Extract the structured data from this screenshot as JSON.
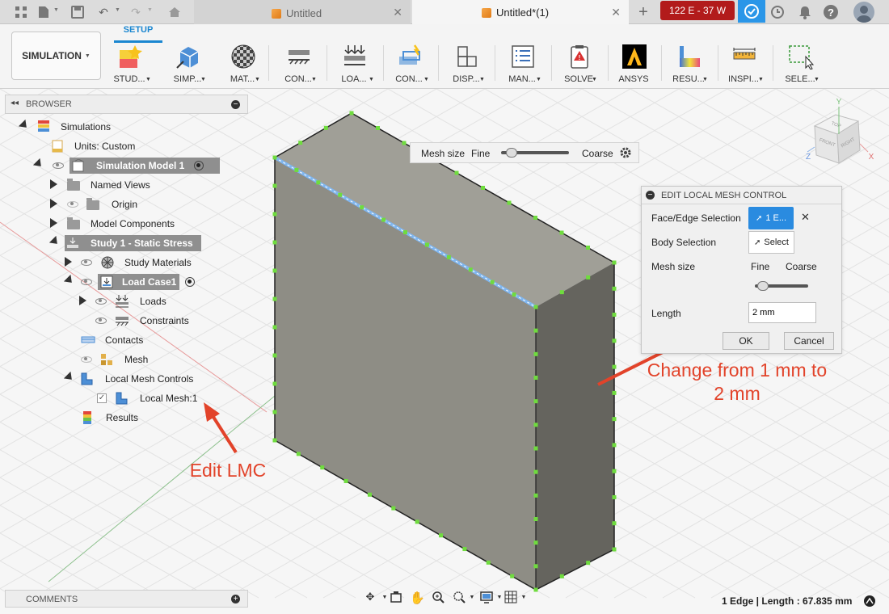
{
  "titlebar": {
    "tabs": [
      {
        "label": "Untitled",
        "active": false
      },
      {
        "label": "Untitled*(1)",
        "active": true
      }
    ],
    "job_status": "122 E - 37 W",
    "icons": [
      "file-icon",
      "save-icon",
      "undo-icon",
      "redo-icon",
      "home-icon",
      "add-tab-icon",
      "sync-icon",
      "clock-icon",
      "bell-icon",
      "help-icon",
      "user-avatar"
    ]
  },
  "ribbon": {
    "workspace": "SIMULATION",
    "active_tab": "SETUP",
    "tools": [
      {
        "label": "STUD...",
        "icon": "study-icon"
      },
      {
        "label": "SIMP...",
        "icon": "simplify-icon"
      },
      {
        "label": "MAT...",
        "icon": "material-icon"
      },
      {
        "label": "CON...",
        "icon": "constraints-icon"
      },
      {
        "label": "LOA...",
        "icon": "loads-icon"
      },
      {
        "label": "CON...",
        "icon": "contacts-icon"
      },
      {
        "label": "DISP...",
        "icon": "display-icon"
      },
      {
        "label": "MAN...",
        "icon": "manage-icon"
      },
      {
        "label": "SOLVE",
        "icon": "solve-icon"
      },
      {
        "label": "ANSYS",
        "icon": "ansys-icon"
      },
      {
        "label": "RESU...",
        "icon": "results-icon"
      },
      {
        "label": "INSPI...",
        "icon": "inspect-icon"
      },
      {
        "label": "SELE...",
        "icon": "select-icon"
      }
    ]
  },
  "browser": {
    "title": "BROWSER",
    "tree": [
      {
        "label": "Simulations"
      },
      {
        "label": "Units: Custom"
      },
      {
        "label": "Simulation Model 1"
      },
      {
        "label": "Named Views"
      },
      {
        "label": "Origin"
      },
      {
        "label": "Model Components"
      },
      {
        "label": "Study 1 - Static Stress"
      },
      {
        "label": "Study Materials"
      },
      {
        "label": "Load Case1"
      },
      {
        "label": "Loads"
      },
      {
        "label": "Constraints"
      },
      {
        "label": "Contacts"
      },
      {
        "label": "Mesh"
      },
      {
        "label": "Local Mesh Controls"
      },
      {
        "label": "Local Mesh:1"
      },
      {
        "label": "Results"
      }
    ]
  },
  "comments": {
    "title": "COMMENTS"
  },
  "meshbar": {
    "label": "Mesh size",
    "fine": "Fine",
    "coarse": "Coarse",
    "level": 0.15
  },
  "dialog": {
    "title": "EDIT LOCAL MESH CONTROL",
    "face_edge_label": "Face/Edge Selection",
    "face_edge_value": "1 E...",
    "body_label": "Body Selection",
    "body_value": "Select",
    "mesh_size_label": "Mesh size",
    "fine": "Fine",
    "coarse": "Coarse",
    "mesh_level": 0.15,
    "length_label": "Length",
    "length_value": "2 mm",
    "ok": "OK",
    "cancel": "Cancel"
  },
  "annotations": {
    "change": "Change from 1 mm to 2 mm",
    "edit": "Edit LMC"
  },
  "viewcube": {
    "top": "TOP",
    "front": "FRONT",
    "right": "RIGHT",
    "axes": [
      "Y",
      "Z",
      "X"
    ]
  },
  "status": {
    "text": "1 Edge | Length : 67.835 mm"
  },
  "colors": {
    "accent": "#1a86d0",
    "annotation": "#e2432a",
    "job_badge": "#b21b1b",
    "mesh_node": "#6fdc3e"
  }
}
